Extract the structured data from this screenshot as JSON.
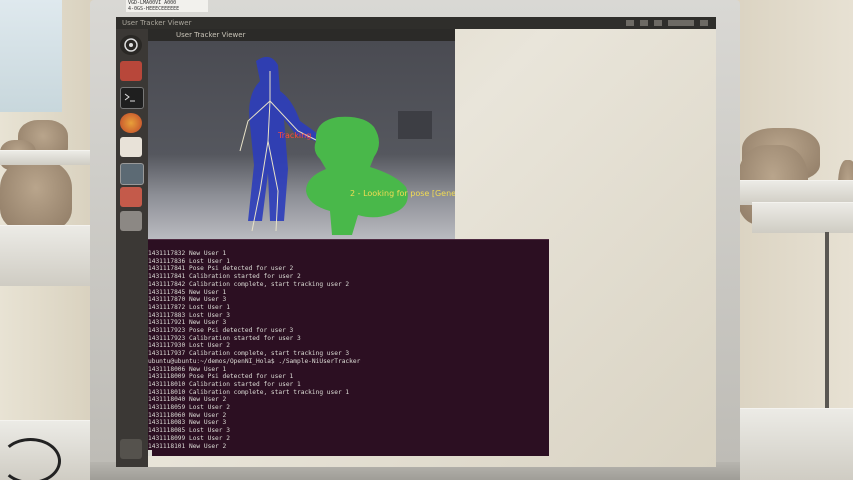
{
  "laptop": {
    "sticker_text": "VGD-LMA00VI A000\n4-0GS-HEEECEEEEEE"
  },
  "window": {
    "topbar_title": "User Tracker Viewer",
    "viewer_title": "User Tracker Viewer"
  },
  "viewer": {
    "tracking_label": "Tracking",
    "pose_label": "2 - Looking for pose [Gene"
  },
  "terminal": {
    "lines": [
      "1431117832 New User 1",
      "1431117836 Lost User 1",
      "1431117841 Pose Psi detected for user 2",
      "1431117841 Calibration started for user 2",
      "1431117842 Calibration complete, start tracking user 2",
      "1431117845 New User 1",
      "1431117870 New User 3",
      "1431117872 Lost User 1",
      "1431117883 Lost User 3",
      "1431117921 New User 3",
      "1431117923 Pose Psi detected for user 3",
      "1431117923 Calibration started for user 3",
      "1431117930 Lost User 2",
      "1431117937 Calibration complete, start tracking user 3",
      "ubuntu@ubuntu:~/demos/OpenNI_Hola$ ./Sample-NiUserTracker",
      "1431118006 New User 1",
      "1431118009 Pose Psi detected for user 1",
      "1431118010 Calibration started for user 1",
      "1431118010 Calibration complete, start tracking user 1",
      "1431118040 New User 2",
      "1431118059 Lost User 2",
      "1431118060 New User 2",
      "1431118083 New User 3",
      "1431118085 Lost User 3",
      "1431118099 Lost User 2",
      "1431118101 New User 2"
    ]
  },
  "colors": {
    "skeleton_user": "#2c3dbb",
    "second_user": "#49b84a",
    "terminal_bg": "#2c0f22",
    "tracking_label": "#ff4a3a",
    "pose_label": "#f2dc53"
  },
  "launcher_icons": [
    "dash-icon",
    "files-icon",
    "terminal-icon",
    "firefox-icon",
    "document-icon",
    "workspace-icon",
    "presentation-icon",
    "app-icon",
    "trash-icon"
  ]
}
